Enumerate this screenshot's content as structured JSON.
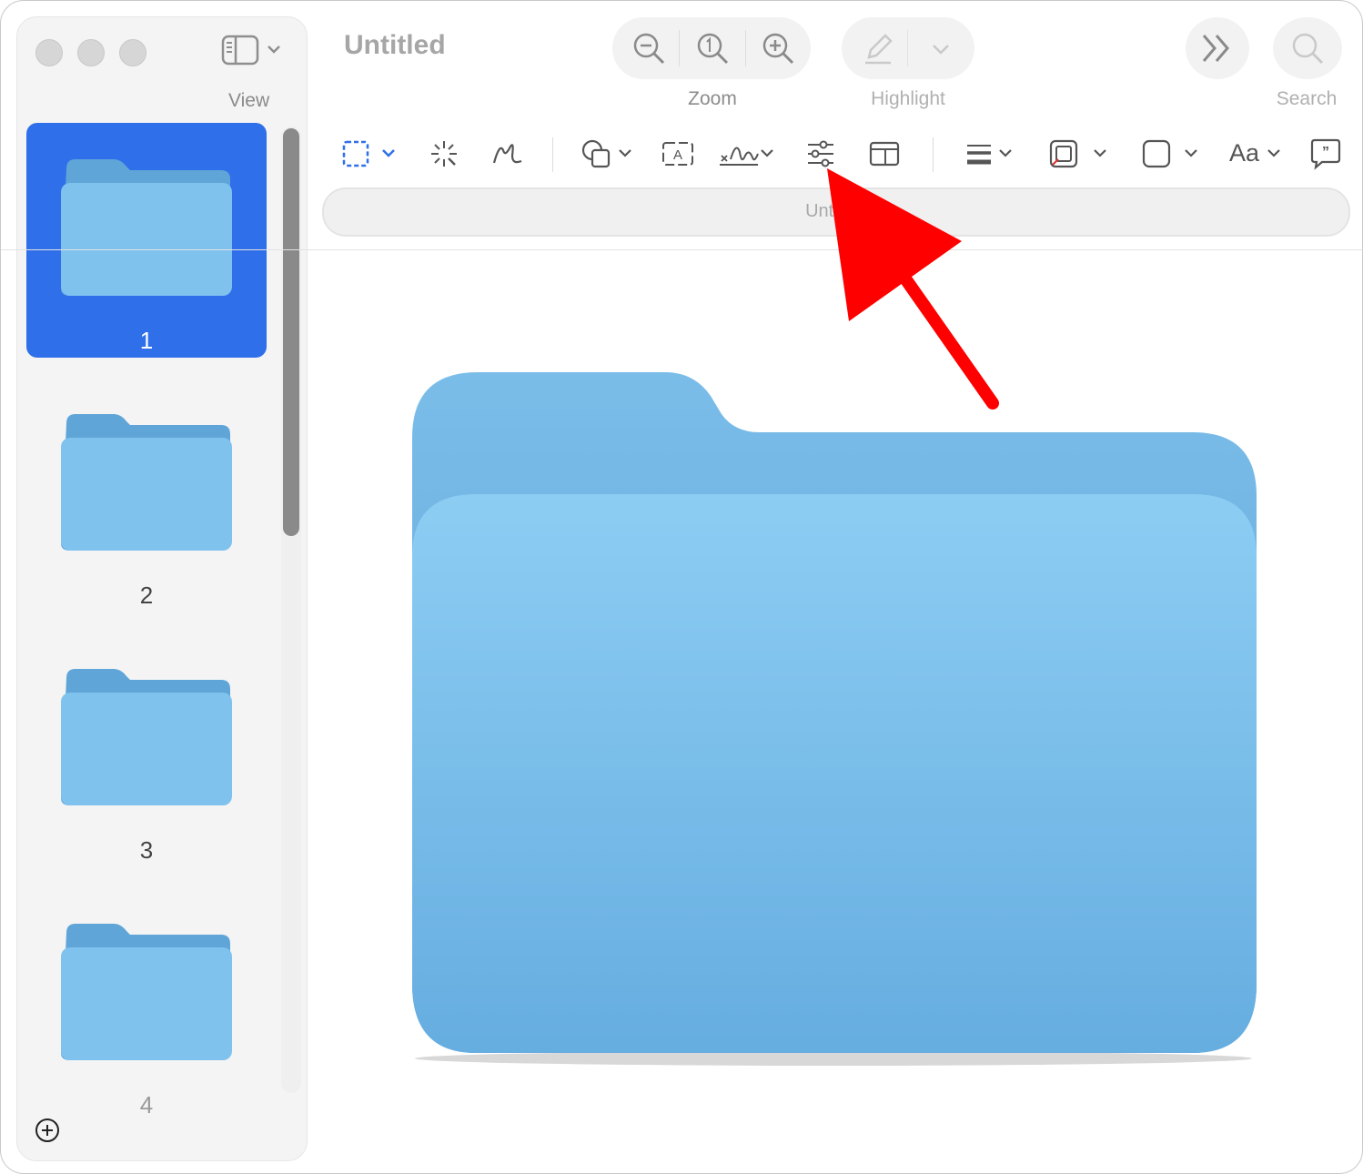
{
  "window": {
    "title": "Untitled",
    "tab_title": "Untitled"
  },
  "sidebar": {
    "view_label": "View",
    "pages": [
      {
        "number": "1",
        "selected": true
      },
      {
        "number": "2",
        "selected": false
      },
      {
        "number": "3",
        "selected": false
      },
      {
        "number": "4",
        "selected": false
      }
    ]
  },
  "toolbar": {
    "zoom_label": "Zoom",
    "highlight_label": "Highlight",
    "search_label": "Search",
    "text_style_label": "Aa"
  },
  "colors": {
    "selection": "#2f6fe9",
    "folder_light": "#8ccdf3",
    "folder_dark": "#5fa5d8",
    "arrow": "#ff0000"
  }
}
